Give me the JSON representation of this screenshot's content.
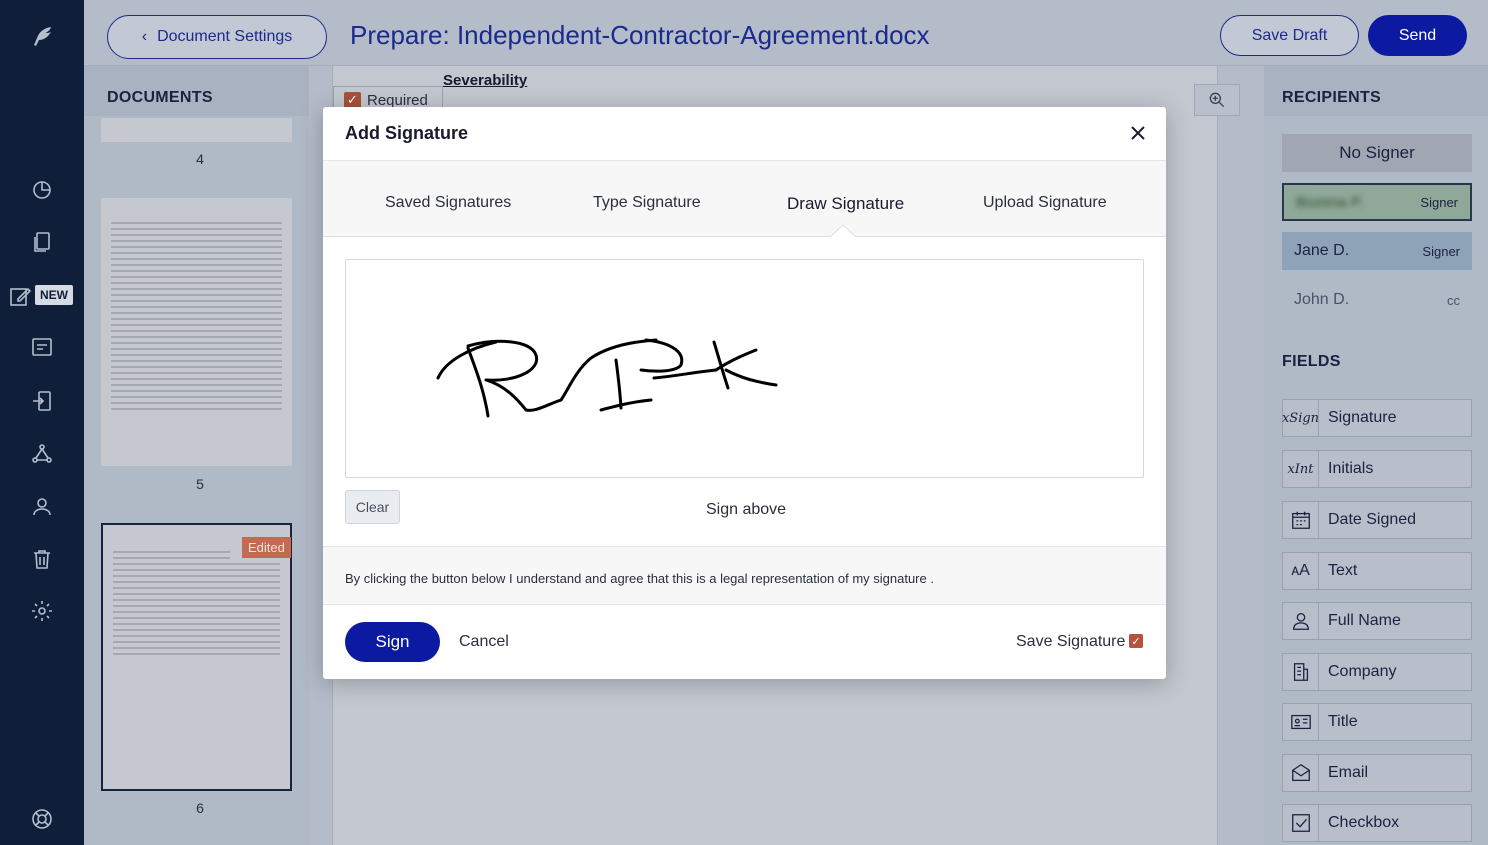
{
  "header": {
    "back_label": "Document Settings",
    "title": "Prepare: Independent-Contractor-Agreement.docx",
    "save_draft_label": "Save Draft",
    "send_label": "Send"
  },
  "nav": {
    "new_badge": "NEW",
    "icons": [
      "feather-logo-icon",
      "pie-chart-icon",
      "documents-icon",
      "edit-icon",
      "templates-icon",
      "import-icon",
      "workflow-icon",
      "contacts-icon",
      "trash-icon",
      "settings-icon",
      "help-icon"
    ]
  },
  "documents": {
    "heading": "DOCUMENTS",
    "pages": [
      {
        "number": "4"
      },
      {
        "number": "5"
      },
      {
        "number": "6",
        "badge": "Edited"
      }
    ]
  },
  "document": {
    "required_label": "Required",
    "section_heading": "Severability"
  },
  "recipients": {
    "heading": "RECIPIENTS",
    "no_signer": "No Signer",
    "list": [
      {
        "name": "Bozena P.",
        "role": "Signer"
      },
      {
        "name": "Jane D.",
        "role": "Signer"
      },
      {
        "name": "John D.",
        "role": "cc"
      }
    ]
  },
  "fields": {
    "heading": "FIELDS",
    "items": [
      {
        "label": "Signature",
        "icon": "signature-icon"
      },
      {
        "label": "Initials",
        "icon": "initials-icon"
      },
      {
        "label": "Date Signed",
        "icon": "calendar-icon"
      },
      {
        "label": "Text",
        "icon": "text-icon"
      },
      {
        "label": "Full Name",
        "icon": "person-icon"
      },
      {
        "label": "Company",
        "icon": "building-icon"
      },
      {
        "label": "Title",
        "icon": "id-card-icon"
      },
      {
        "label": "Email",
        "icon": "envelope-icon"
      },
      {
        "label": "Checkbox",
        "icon": "checkbox-icon"
      }
    ]
  },
  "modal": {
    "title": "Add Signature",
    "tabs": [
      "Saved Signatures",
      "Type Signature",
      "Draw Signature",
      "Upload Signature"
    ],
    "active_tab": "Draw Signature",
    "clear_label": "Clear",
    "sign_above": "Sign above",
    "legal_text": "By clicking the button below I understand and agree that this is a legal representation of my signature .",
    "sign_label": "Sign",
    "cancel_label": "Cancel",
    "save_signature_label": "Save Signature",
    "save_signature_checked": true
  }
}
